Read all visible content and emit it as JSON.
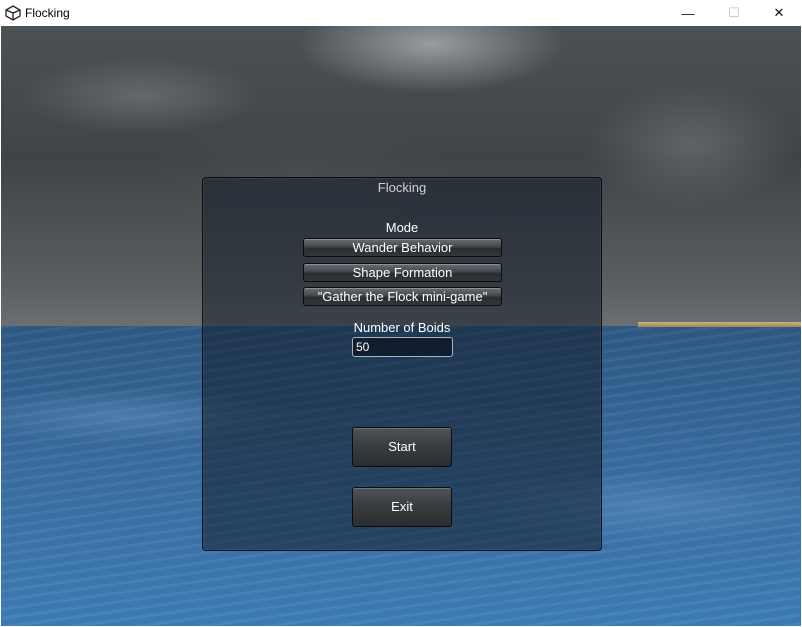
{
  "window": {
    "title": "Flocking",
    "app_icon": "unity-icon",
    "controls": {
      "minimize": "—",
      "maximize": "☐",
      "close": "✕"
    }
  },
  "scene": {
    "sky_color": "#4b5154",
    "sea_color": "#3a6ea2"
  },
  "panel": {
    "title": "Flocking",
    "mode_label": "Mode",
    "modes": [
      "Wander Behavior",
      "Shape Formation",
      "\"Gather the Flock mini-game\""
    ],
    "boids_label": "Number of Boids",
    "boids_value": "50",
    "start_label": "Start",
    "exit_label": "Exit"
  }
}
